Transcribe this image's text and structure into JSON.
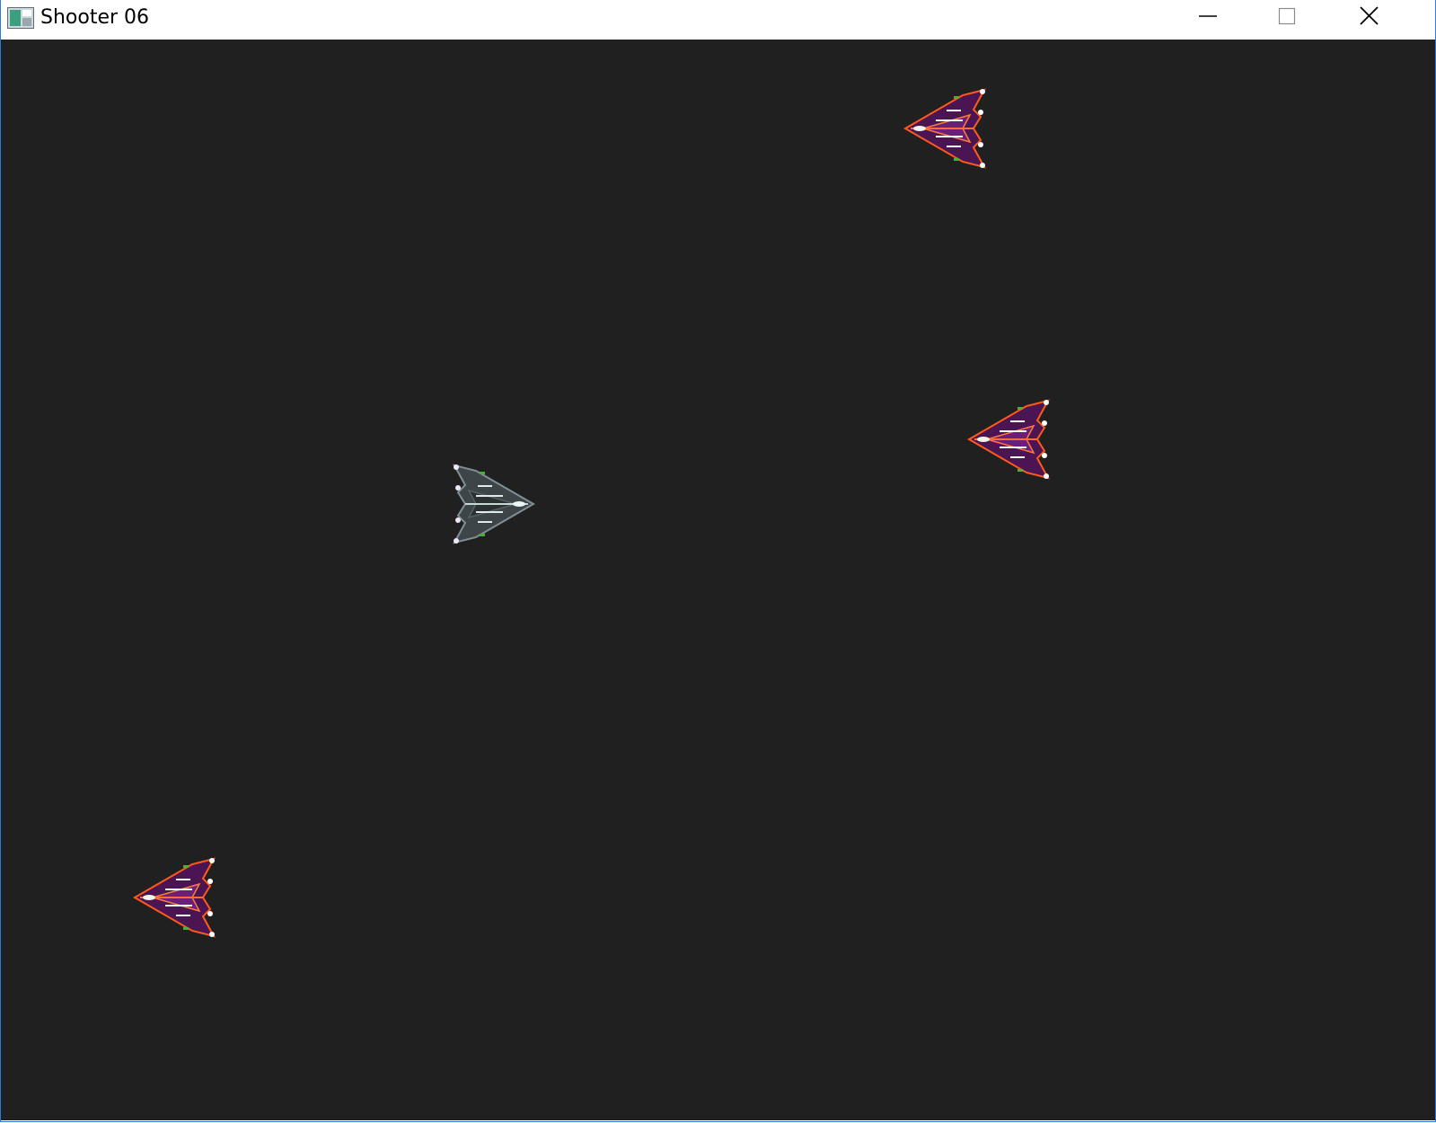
{
  "window": {
    "title": "Shooter 06",
    "app_icon": "app-icon",
    "controls": {
      "minimize_icon": "minimize-icon",
      "maximize_icon": "maximize-icon",
      "close_icon": "close-icon"
    }
  },
  "game": {
    "background_color": "#202020",
    "player": {
      "sprite": "player-ship",
      "colors": [
        "#5a6268",
        "#9fb3b8",
        "#e9f6f4"
      ],
      "facing": "right"
    },
    "enemies": [
      {
        "sprite": "enemy-ship",
        "colors": [
          "#ff5a1a",
          "#5b1a63",
          "#ffffff"
        ],
        "facing": "left"
      },
      {
        "sprite": "enemy-ship",
        "colors": [
          "#ff5a1a",
          "#5b1a63",
          "#ffffff"
        ],
        "facing": "left"
      },
      {
        "sprite": "enemy-ship",
        "colors": [
          "#ff5a1a",
          "#5b1a63",
          "#ffffff"
        ],
        "facing": "left"
      }
    ]
  }
}
